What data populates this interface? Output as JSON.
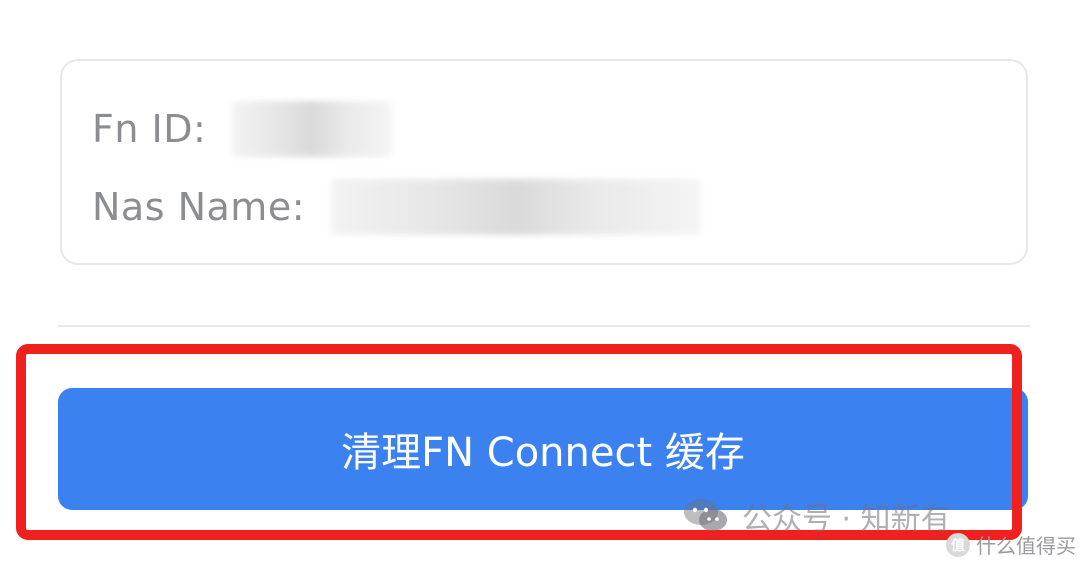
{
  "info_card": {
    "fn_id_label": "Fn ID:",
    "nas_name_label": "Nas Name:"
  },
  "action": {
    "clear_cache_label": "清理FN Connect 缓存"
  },
  "watermark": {
    "account_text": "公众号 · 知新有",
    "site_text": "什么值得买",
    "site_logo_glyph": "值"
  },
  "colors": {
    "button": "#3b82f0",
    "highlight": "#f0201e",
    "label": "#8c8d92"
  }
}
